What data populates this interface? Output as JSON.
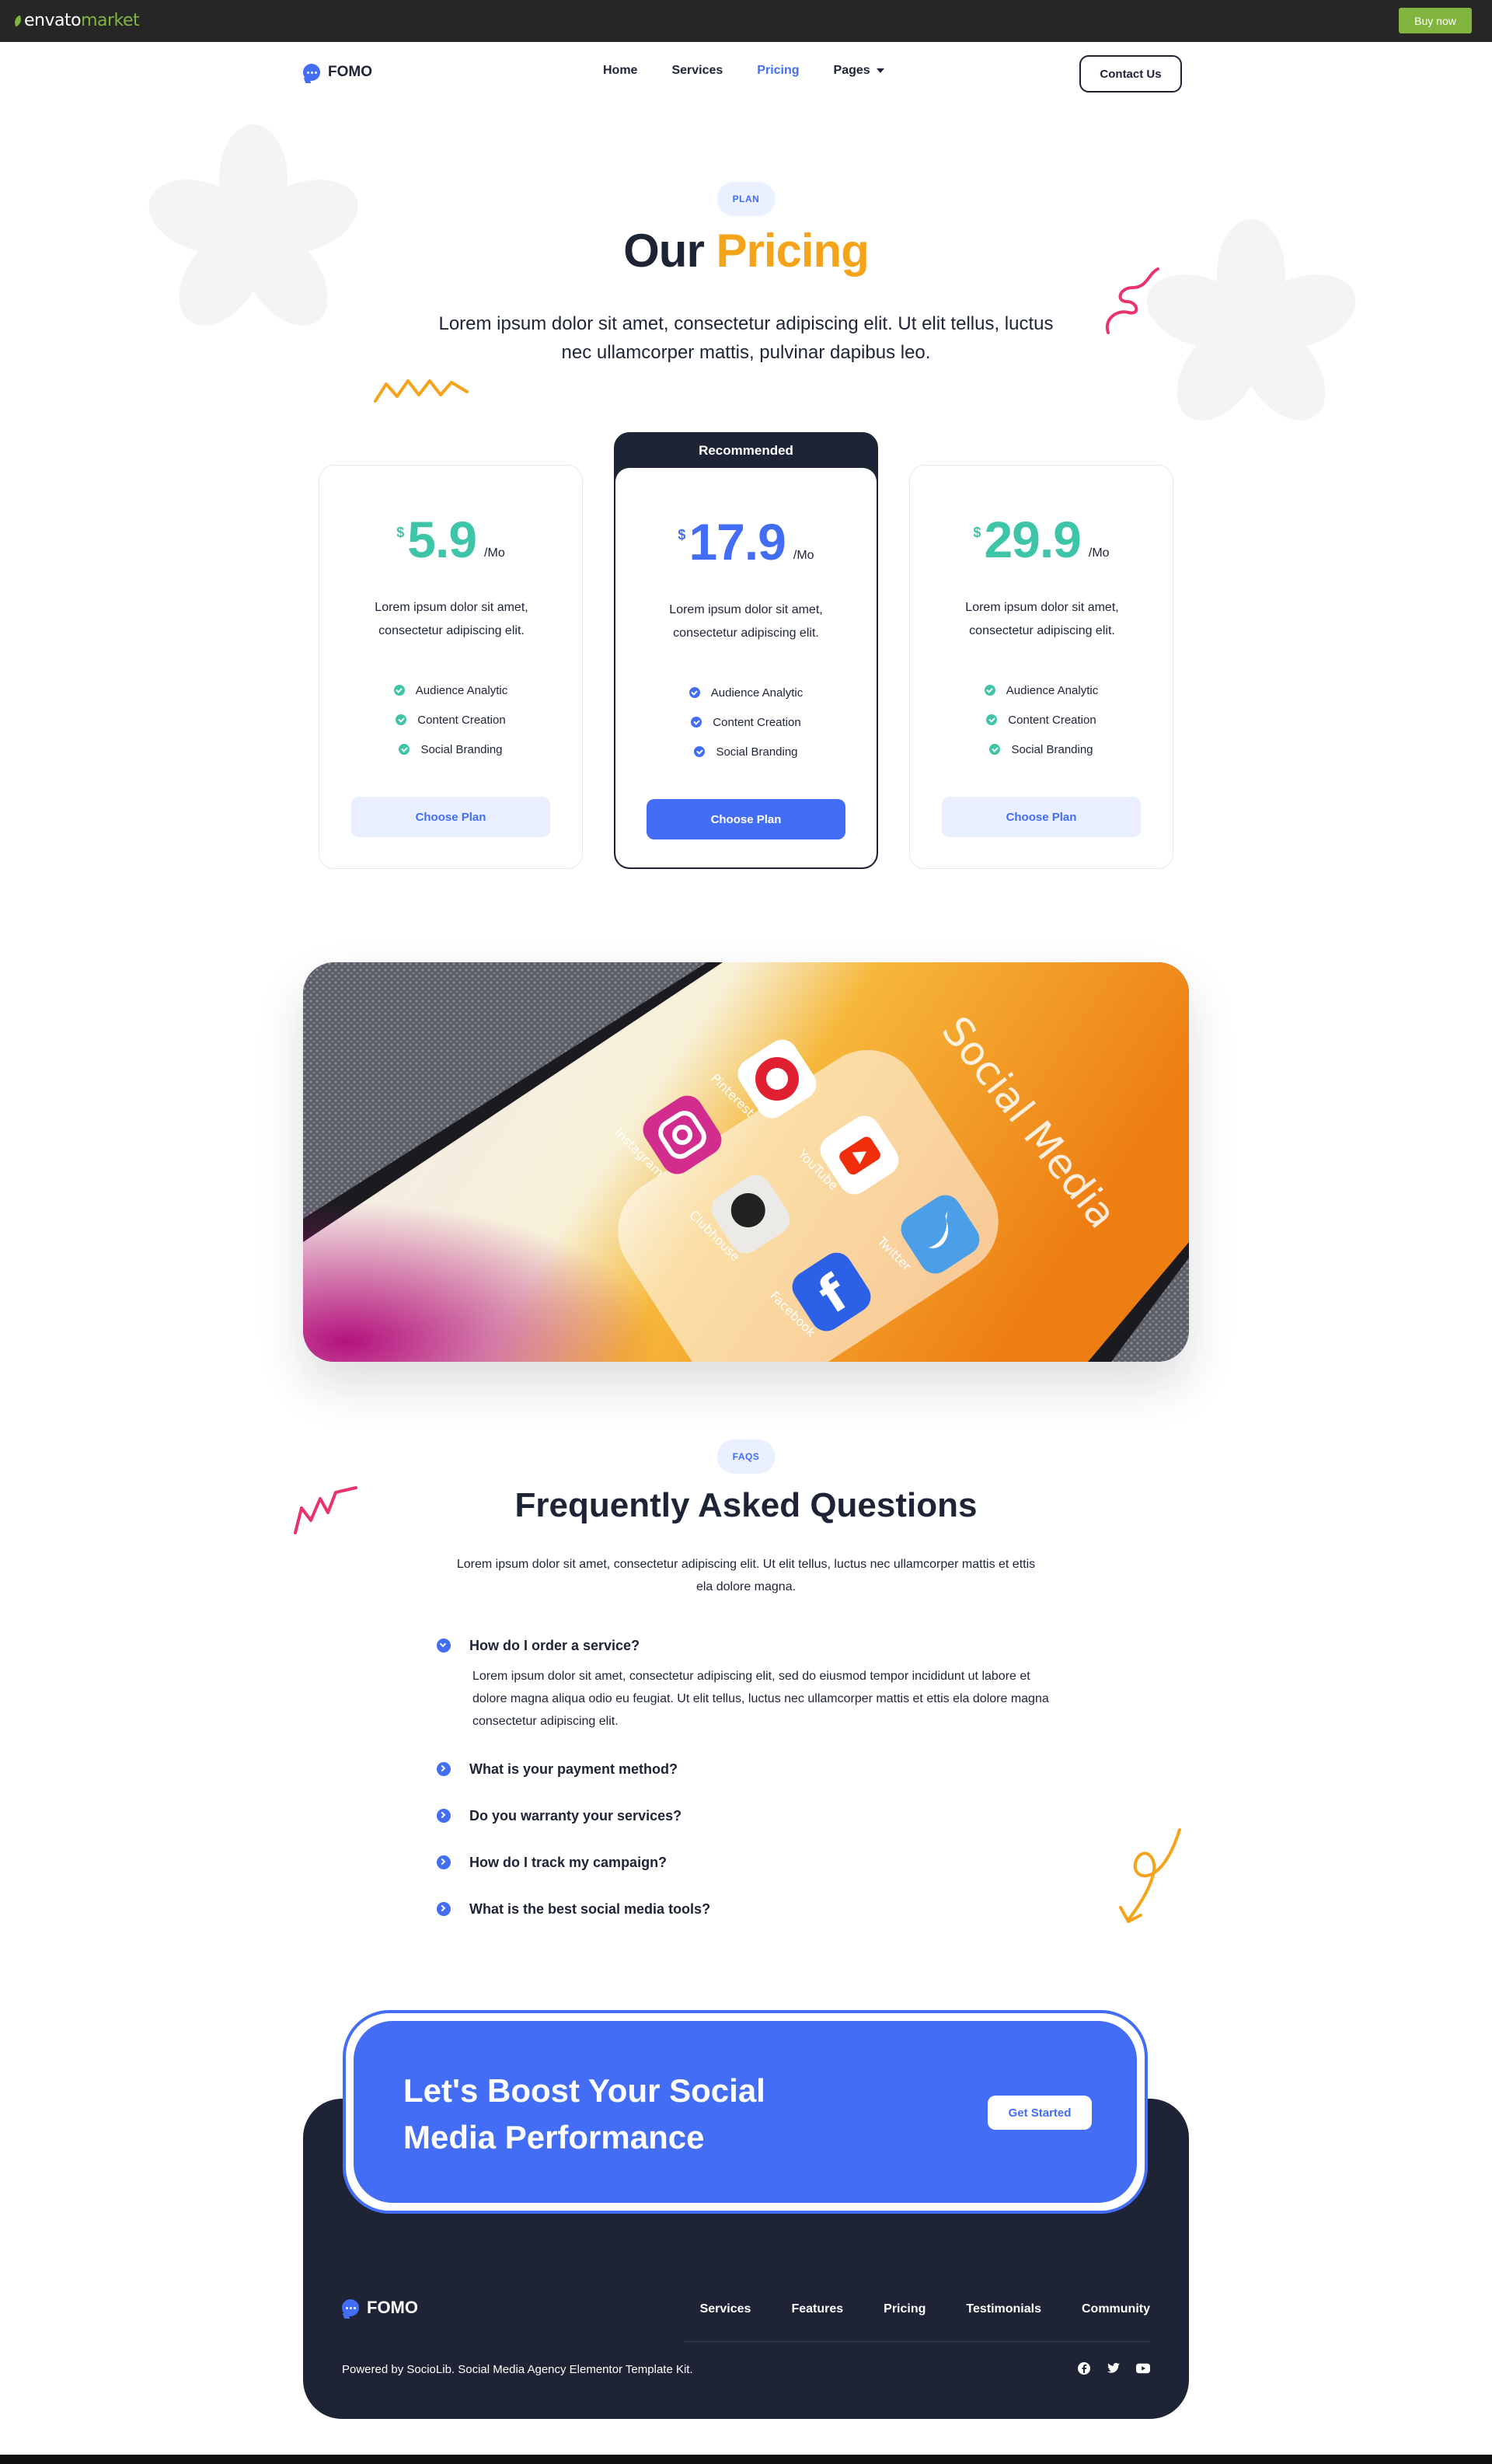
{
  "topbar": {
    "logo_main": "envato",
    "logo_sub": "market",
    "buy_label": "Buy now"
  },
  "nav": {
    "brand": "FOMO",
    "links": [
      {
        "label": "Home",
        "active": false
      },
      {
        "label": "Services",
        "active": false
      },
      {
        "label": "Pricing",
        "active": true
      },
      {
        "label": "Pages",
        "active": false
      }
    ],
    "contact_label": "Contact Us"
  },
  "hero": {
    "badge": "PLAN",
    "title_part1": "Our",
    "title_part2": "Pricing",
    "subtitle": "Lorem ipsum dolor sit amet, consectetur adipiscing elit. Ut elit tellus, luctus nec ullamcorper mattis, pulvinar dapibus leo."
  },
  "pricing": {
    "recommended_label": "Recommended",
    "plans": [
      {
        "currency": "$",
        "amount": "5.9",
        "period": "/Mo",
        "description": "Lorem ipsum dolor sit amet, consectetur adipiscing elit.",
        "features": [
          "Audience Analytic",
          "Content Creation",
          "Social Branding"
        ],
        "button": "Choose Plan",
        "color": "#3ec5a8"
      },
      {
        "currency": "$",
        "amount": "17.9",
        "period": "/Mo",
        "description": "Lorem ipsum dolor sit amet, consectetur adipiscing elit.",
        "features": [
          "Audience Analytic",
          "Content Creation",
          "Social Branding"
        ],
        "button": "Choose Plan",
        "color": "#436df5"
      },
      {
        "currency": "$",
        "amount": "29.9",
        "period": "/Mo",
        "description": "Lorem ipsum dolor sit amet, consectetur adipiscing elit.",
        "features": [
          "Audience Analytic",
          "Content Creation",
          "Social Branding"
        ],
        "button": "Choose Plan",
        "color": "#3ec5a8"
      }
    ]
  },
  "photo": {
    "folder_title": "Social Media",
    "apps": [
      "Pinterest",
      "Instagram",
      "YouTube",
      "Clubhouse",
      "Twitter",
      "Facebook"
    ]
  },
  "faq": {
    "badge": "FAQS",
    "title": "Frequently Asked Questions",
    "subtitle": "Lorem ipsum dolor sit amet, consectetur adipiscing elit. Ut elit tellus, luctus nec ullamcorper mattis et ettis ela dolore magna.",
    "items": [
      {
        "q": "How do I order a service?",
        "open": true,
        "a": "Lorem ipsum dolor sit amet, consectetur adipiscing elit, sed do eiusmod tempor incididunt ut labore et dolore magna aliqua odio eu feugiat. Ut elit tellus, luctus nec ullamcorper mattis et ettis ela dolore magna consectetur adipiscing elit."
      },
      {
        "q": "What is your payment method?",
        "open": false
      },
      {
        "q": "Do you warranty your services?",
        "open": false
      },
      {
        "q": "How do I track my campaign?",
        "open": false
      },
      {
        "q": "What is the best social media tools?",
        "open": false
      }
    ]
  },
  "cta": {
    "title": "Let's Boost Your Social Media Performance",
    "button": "Get Started"
  },
  "footer": {
    "brand": "FOMO",
    "links": [
      "Services",
      "Features",
      "Pricing",
      "Testimonials",
      "Community"
    ],
    "copyright": "Powered by SocioLib. Social Media Agency Elementor Template Kit.",
    "socials": [
      "facebook-icon",
      "twitter-icon",
      "youtube-icon"
    ]
  },
  "colors": {
    "primary": "#436df5",
    "dark": "#1e2336",
    "accent": "#f5a31a",
    "teal": "#3ec5a8",
    "pink": "#e8336b"
  }
}
